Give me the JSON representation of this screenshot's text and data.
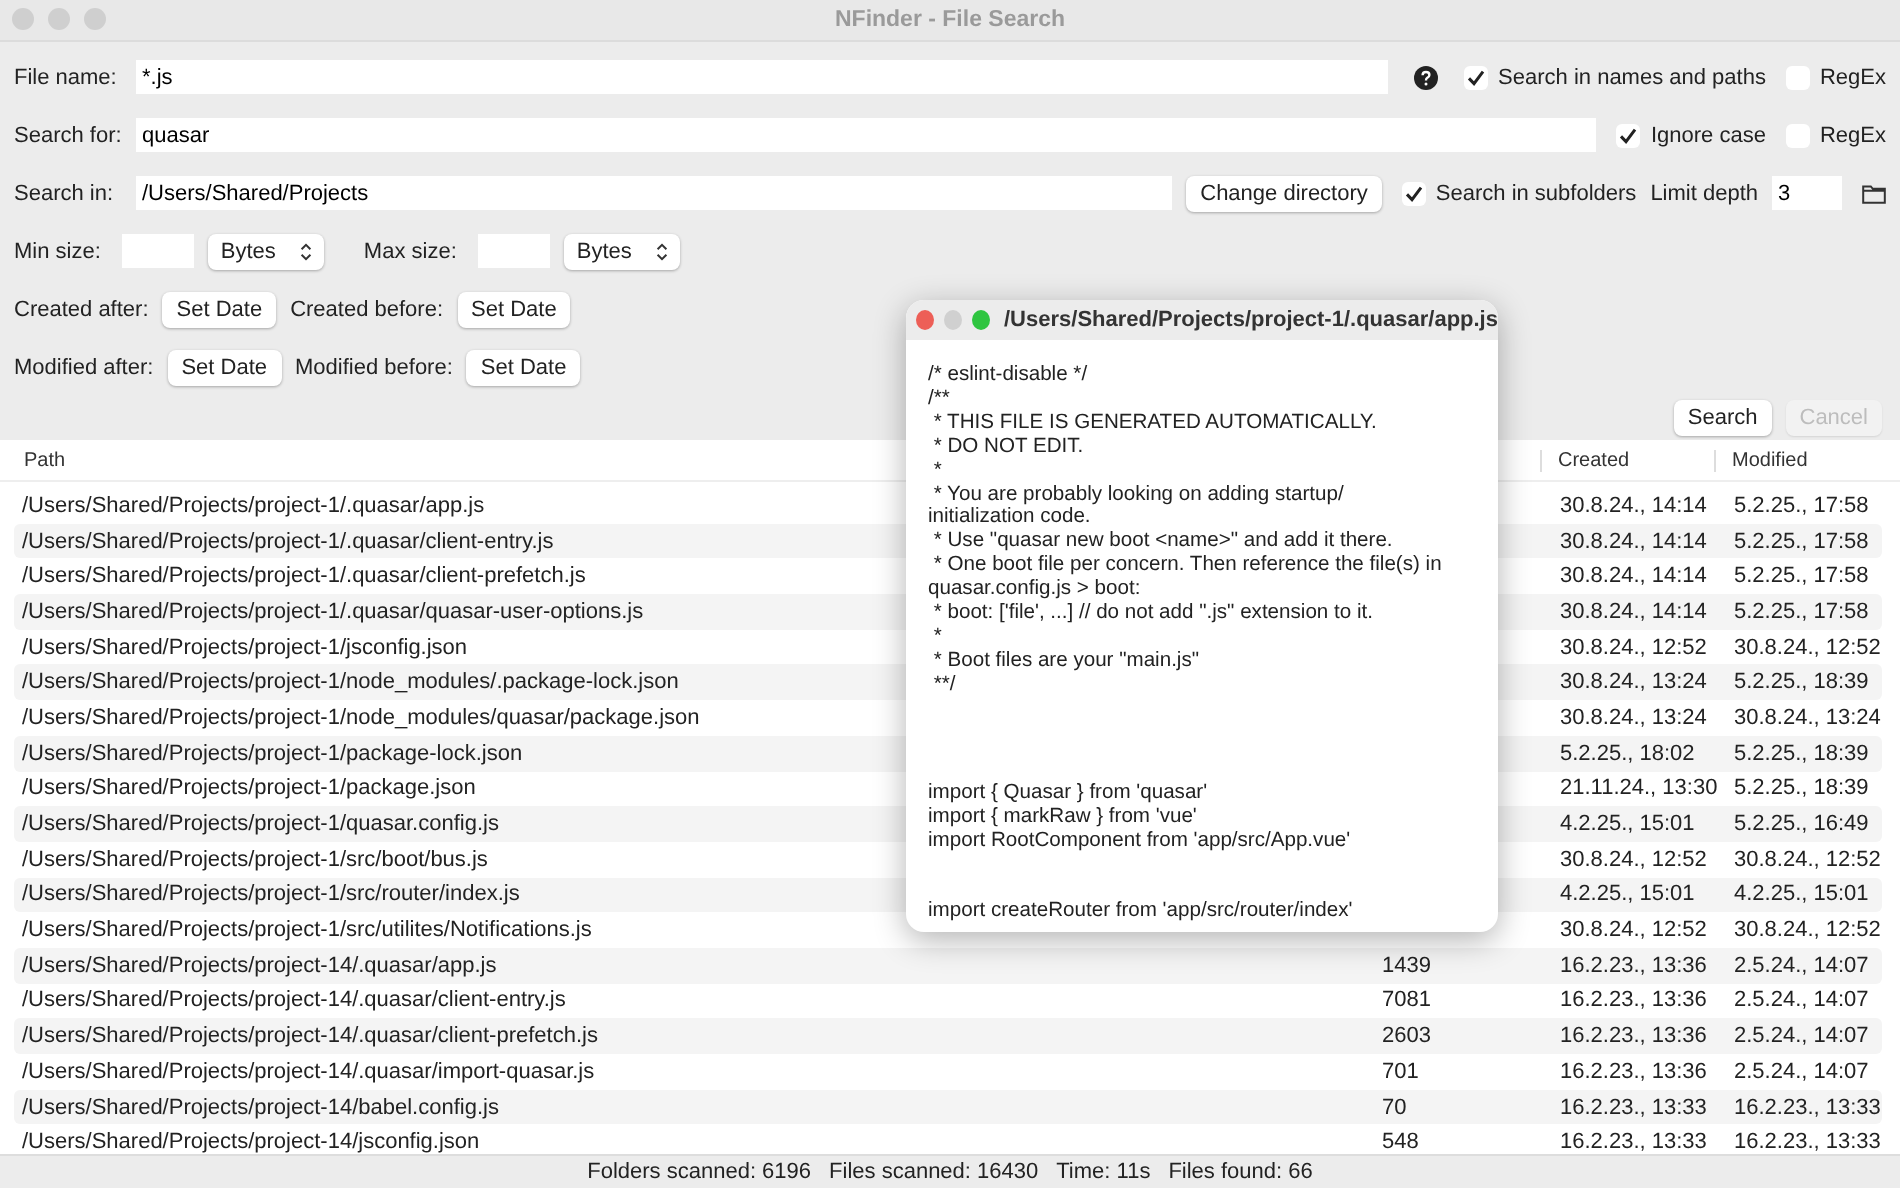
{
  "window": {
    "title": "NFinder - File Search"
  },
  "form": {
    "file_name": {
      "label": "File name:",
      "value": "*.js",
      "search_names_paths": {
        "label": "Search in names and paths",
        "checked": true
      },
      "regex": {
        "label": "RegEx",
        "checked": false
      }
    },
    "search_for": {
      "label": "Search for:",
      "value": "quasar",
      "ignore_case": {
        "label": "Ignore case",
        "checked": true
      },
      "regex": {
        "label": "RegEx",
        "checked": false
      }
    },
    "search_in": {
      "label": "Search in:",
      "value": "/Users/Shared/Projects",
      "change_button": "Change directory",
      "subfolders": {
        "label": "Search in subfolders",
        "checked": true
      },
      "limit_label": "Limit depth",
      "limit_value": "3"
    },
    "min_size": {
      "label": "Min size:",
      "unit": "Bytes"
    },
    "max_size": {
      "label": "Max size:",
      "unit": "Bytes"
    },
    "created_after": {
      "label": "Created after:",
      "button": "Set Date"
    },
    "created_before": {
      "label": "Created before:",
      "button": "Set Date"
    },
    "modified_after": {
      "label": "Modified after:",
      "button": "Set Date"
    },
    "modified_before": {
      "label": "Modified before:",
      "button": "Set Date"
    },
    "buttons": [
      {
        "label": "Search",
        "disabled": false
      },
      {
        "label": "Cancel",
        "disabled": true
      }
    ]
  },
  "table": {
    "columns": [
      "Path",
      "Created",
      "Modified"
    ],
    "rows": [
      {
        "path": "/Users/Shared/Projects/project-1/.quasar/app.js",
        "created": "30.8.24., 14:14",
        "modified": "5.2.25., 17:58"
      },
      {
        "path": "/Users/Shared/Projects/project-1/.quasar/client-entry.js",
        "created": "30.8.24., 14:14",
        "modified": "5.2.25., 17:58"
      },
      {
        "path": "/Users/Shared/Projects/project-1/.quasar/client-prefetch.js",
        "created": "30.8.24., 14:14",
        "modified": "5.2.25., 17:58"
      },
      {
        "path": "/Users/Shared/Projects/project-1/.quasar/quasar-user-options.js",
        "created": "30.8.24., 14:14",
        "modified": "5.2.25., 17:58"
      },
      {
        "path": "/Users/Shared/Projects/project-1/jsconfig.json",
        "created": "30.8.24., 12:52",
        "modified": "30.8.24., 12:52"
      },
      {
        "path": "/Users/Shared/Projects/project-1/node_modules/.package-lock.json",
        "created": "30.8.24., 13:24",
        "modified": "5.2.25., 18:39"
      },
      {
        "path": "/Users/Shared/Projects/project-1/node_modules/quasar/package.json",
        "created": "30.8.24., 13:24",
        "modified": "30.8.24., 13:24"
      },
      {
        "path": "/Users/Shared/Projects/project-1/package-lock.json",
        "created": "5.2.25., 18:02",
        "modified": "5.2.25., 18:39"
      },
      {
        "path": "/Users/Shared/Projects/project-1/package.json",
        "created": "21.11.24., 13:30",
        "modified": "5.2.25., 18:39"
      },
      {
        "path": "/Users/Shared/Projects/project-1/quasar.config.js",
        "created": "4.2.25., 15:01",
        "modified": "5.2.25., 16:49"
      },
      {
        "path": "/Users/Shared/Projects/project-1/src/boot/bus.js",
        "created": "30.8.24., 12:52",
        "modified": "30.8.24., 12:52"
      },
      {
        "path": "/Users/Shared/Projects/project-1/src/router/index.js",
        "created": "4.2.25., 15:01",
        "modified": "4.2.25., 15:01"
      },
      {
        "path": "/Users/Shared/Projects/project-1/src/utilites/Notifications.js",
        "created": "30.8.24., 12:52",
        "modified": "30.8.24., 12:52"
      },
      {
        "path": "/Users/Shared/Projects/project-14/.quasar/app.js",
        "size": "1439",
        "created": "16.2.23., 13:36",
        "modified": "2.5.24., 14:07"
      },
      {
        "path": "/Users/Shared/Projects/project-14/.quasar/client-entry.js",
        "size": "7081",
        "created": "16.2.23., 13:36",
        "modified": "2.5.24., 14:07"
      },
      {
        "path": "/Users/Shared/Projects/project-14/.quasar/client-prefetch.js",
        "size": "2603",
        "created": "16.2.23., 13:36",
        "modified": "2.5.24., 14:07"
      },
      {
        "path": "/Users/Shared/Projects/project-14/.quasar/import-quasar.js",
        "size": "701",
        "created": "16.2.23., 13:36",
        "modified": "2.5.24., 14:07"
      },
      {
        "path": "/Users/Shared/Projects/project-14/babel.config.js",
        "size": "70",
        "created": "16.2.23., 13:33",
        "modified": "16.2.23., 13:33"
      },
      {
        "path": "/Users/Shared/Projects/project-14/jsconfig.json",
        "size": "548",
        "created": "16.2.23., 13:33",
        "modified": "16.2.23., 13:33"
      }
    ]
  },
  "status_bar": [
    "Folders scanned: 6196",
    "Files scanned: 16430",
    "Time: 11s",
    "Files found: 66"
  ],
  "preview": {
    "title": "/Users/Shared/Projects/project-1/.quasar/app.js",
    "blocks": [
      [
        "/* eslint-disable */",
        "/**",
        " * THIS FILE IS GENERATED AUTOMATICALLY.",
        " * DO NOT EDIT.",
        " *",
        " * You are probably looking on adding startup/ initialization code.",
        " * Use \"quasar new boot <name>\" and add it there.",
        " * One boot file per concern. Then reference the file(s) in quasar.config.js > boot:",
        " * boot: ['file', ...] // do not add \".js\" extension to it.",
        " *",
        " * Boot files are your \"main.js\"",
        " **/"
      ],
      [
        "import { Quasar } from 'quasar'",
        "import { markRaw } from 'vue'",
        "import RootComponent from 'app/src/App.vue'"
      ],
      [
        "import createRouter from 'app/src/router/index'"
      ]
    ]
  }
}
